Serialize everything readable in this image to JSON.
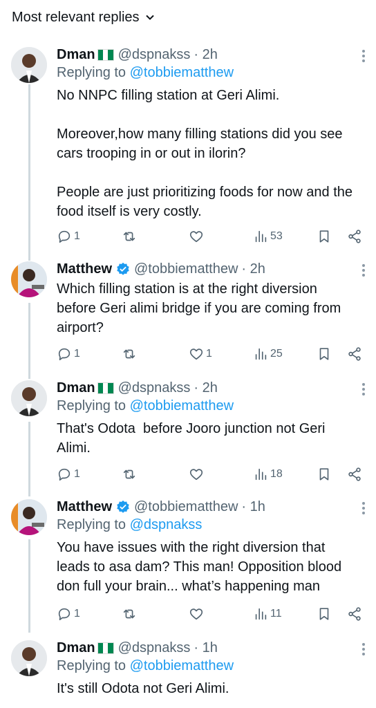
{
  "header": {
    "title": "Most relevant replies"
  },
  "replies": [
    {
      "name": "Dman",
      "handle": "@dspnakss",
      "time": "· 2h",
      "replying_prefix": "Replying to ",
      "replying_to": "@tobbiematthew",
      "text": "No NNPC filling station at Geri Alimi.\n\nMoreover,how many filling stations did you see\ncars trooping in or out in ilorin?\n\nPeople are just prioritizing foods for now and the\nfood itself is very costly.",
      "replies_count": "1",
      "retweets_count": "",
      "likes_count": "",
      "views_count": "53"
    },
    {
      "name": "Matthew",
      "handle": "@tobbiematthew",
      "time": "· 2h",
      "text": "Which filling station is at the right diversion\nbefore Geri alimi bridge if you are coming from\nairport?",
      "replies_count": "1",
      "retweets_count": "",
      "likes_count": "1",
      "views_count": "25"
    },
    {
      "name": "Dman",
      "handle": "@dspnakss",
      "time": "· 2h",
      "replying_prefix": "Replying to ",
      "replying_to": "@tobbiematthew",
      "text": "That's Odota  before Jooro junction not Geri\nAlimi.",
      "replies_count": "1",
      "retweets_count": "",
      "likes_count": "",
      "views_count": "18"
    },
    {
      "name": "Matthew",
      "handle": "@tobbiematthew",
      "time": "· 1h",
      "replying_prefix": "Replying to ",
      "replying_to": "@dspnakss",
      "text": "You have issues with the right diversion that\nleads to asa dam? This man! Opposition blood\ndon full your brain... what’s happening man",
      "replies_count": "1",
      "retweets_count": "",
      "likes_count": "",
      "views_count": "11"
    },
    {
      "name": "Dman",
      "handle": "@dspnakss",
      "time": "· 1h",
      "replying_prefix": "Replying to ",
      "replying_to": "@tobbiematthew",
      "text": "It's still Odota not Geri Alimi."
    }
  ],
  "colors": {
    "link": "#1d9bf0",
    "verified": "#1d9bf0",
    "secondary": "#536471",
    "flag_green": "#008751"
  }
}
